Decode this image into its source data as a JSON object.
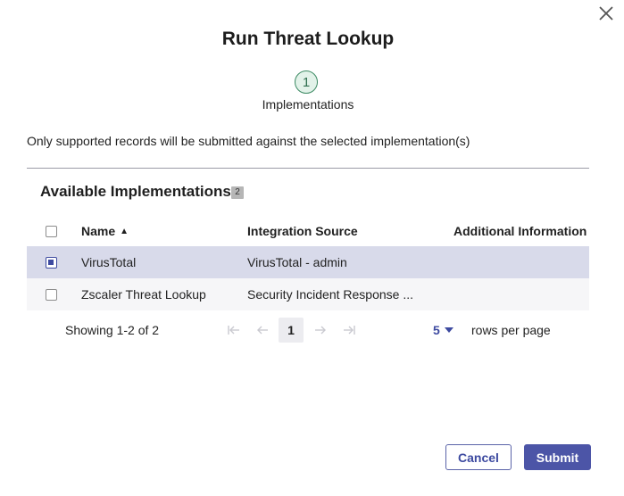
{
  "dialog": {
    "title": "Run Threat Lookup",
    "close_icon": "close-icon"
  },
  "stepper": {
    "step_number": "1",
    "step_label": "Implementations"
  },
  "notice": "Only supported records will be submitted against the selected implementation(s)",
  "section": {
    "title": "Available Implementations",
    "count": "2"
  },
  "table": {
    "columns": {
      "name": "Name",
      "source": "Integration Source",
      "info": "Additional Information"
    },
    "sort_icon": "sort-ascending-icon",
    "rows": [
      {
        "name": "VirusTotal",
        "source": "VirusTotal - admin",
        "info": "",
        "checked": true
      },
      {
        "name": "Zscaler Threat Lookup",
        "source": "Security Incident Response ...",
        "info": "",
        "checked": false
      }
    ]
  },
  "pagination": {
    "showing": "Showing 1-2 of 2",
    "current_page": "1",
    "rows_per_page_value": "5",
    "rows_per_page_label": "rows per page"
  },
  "buttons": {
    "cancel": "Cancel",
    "submit": "Submit"
  },
  "colors": {
    "accent": "#3d4aa0",
    "primary_button": "#4c55a7",
    "selected_row": "#d8daea",
    "step_circle": "#e2f2e9"
  }
}
